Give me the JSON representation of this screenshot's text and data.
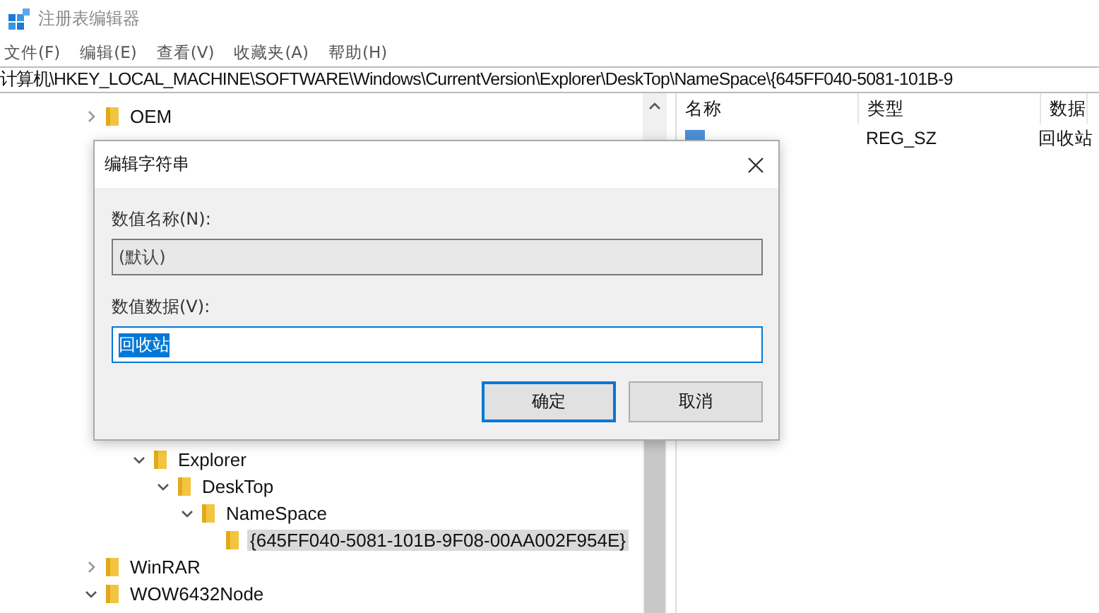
{
  "window": {
    "title": "注册表编辑器"
  },
  "menu": [
    "文件(F)",
    "编辑(E)",
    "查看(V)",
    "收藏夹(A)",
    "帮助(H)"
  ],
  "address": "计算机\\HKEY_LOCAL_MACHINE\\SOFTWARE\\Windows\\CurrentVersion\\Explorer\\DeskTop\\NameSpace\\{645FF040-5081-101B-9",
  "tree": {
    "top_items": [
      {
        "label": "OEM",
        "expanded": false
      }
    ],
    "lower_items": [
      {
        "label": "Explorer",
        "expanded": true,
        "selected": false,
        "children": [
          {
            "label": "DeskTop",
            "expanded": true,
            "selected": false,
            "children": [
              {
                "label": "NameSpace",
                "expanded": true,
                "selected": false,
                "children": [
                  {
                    "label": "{645FF040-5081-101B-9F08-00AA002F954E}",
                    "selected": true
                  }
                ]
              }
            ]
          }
        ]
      }
    ],
    "tail_items": [
      {
        "label": "WinRAR",
        "expanded": false
      },
      {
        "label": "WOW6432Node",
        "expanded": true
      }
    ]
  },
  "values": {
    "columns": [
      "名称",
      "类型",
      "数据"
    ],
    "rows": [
      {
        "type": "REG_SZ",
        "data": "回收站"
      }
    ]
  },
  "dialog": {
    "title": "编辑字符串",
    "name_label": "数值名称(N):",
    "name_value": "(默认)",
    "data_label": "数值数据(V):",
    "data_value": "回收站",
    "buttons": [
      {
        "label": "确定",
        "default": true
      },
      {
        "label": "取消",
        "default": false
      }
    ]
  }
}
